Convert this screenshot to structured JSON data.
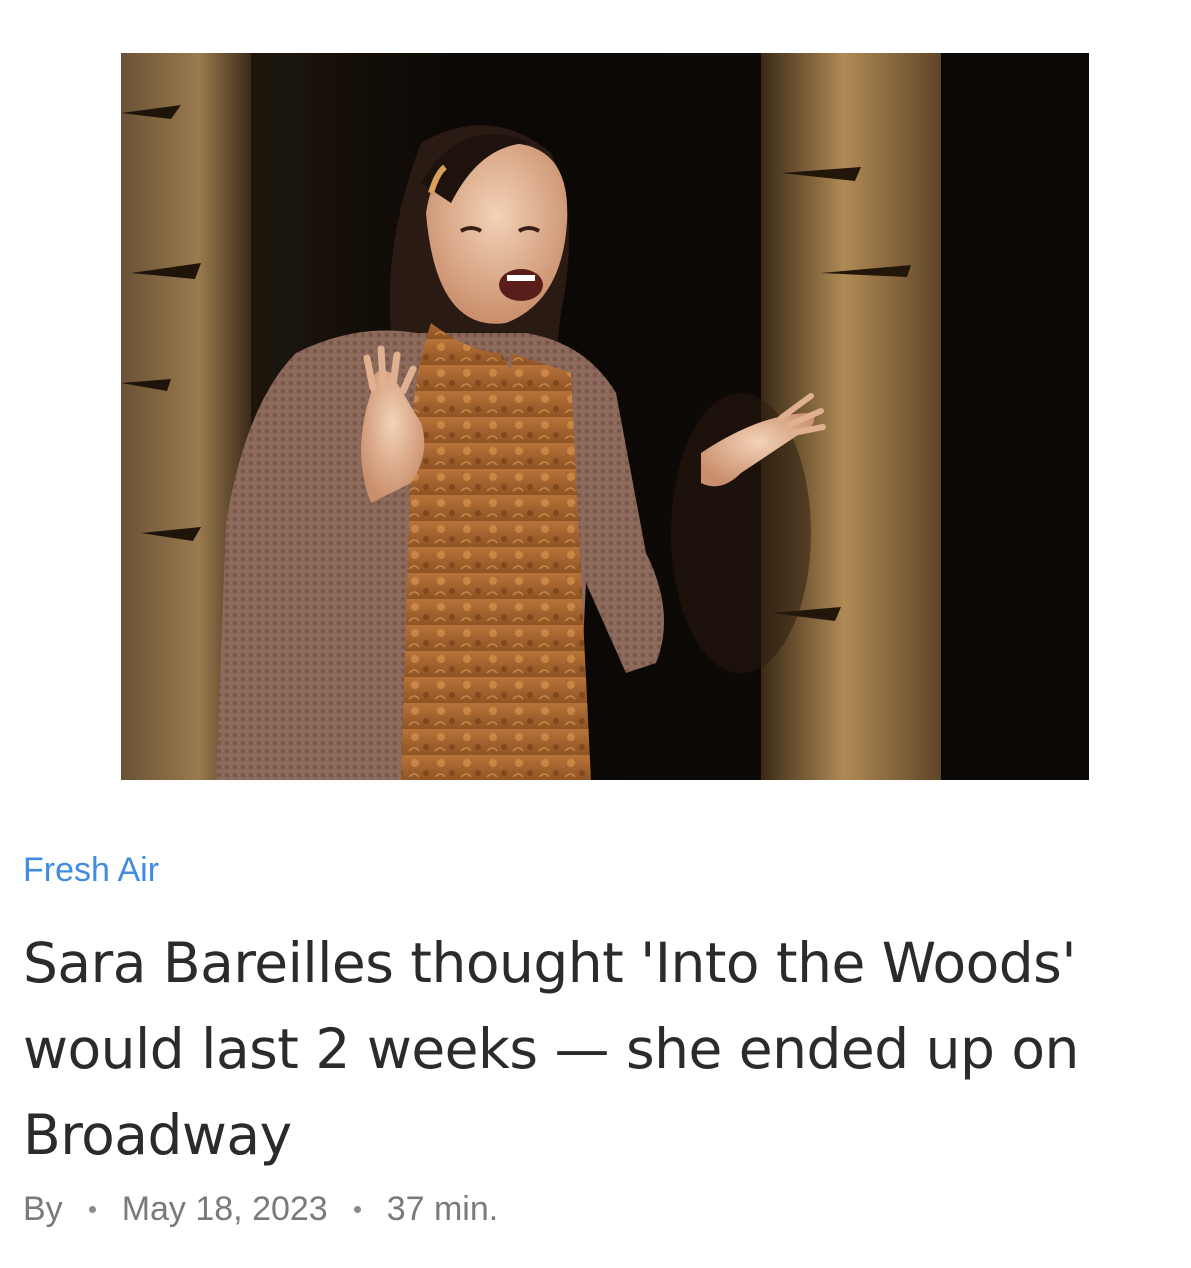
{
  "story": {
    "program": "Fresh Air",
    "headline": "Sara Bareilles thought 'Into the Woods' would last 2 weeks — she ended up on Broadway",
    "byline_prefix": "By",
    "date": "May 18, 2023",
    "duration": "37 min."
  },
  "colors": {
    "program_link": "#3f8ce0",
    "headline_text": "#2b2b2b",
    "meta_text": "#7a7a7a",
    "background": "#ffffff"
  },
  "icons": {
    "separator": "bullet-dot-icon"
  }
}
